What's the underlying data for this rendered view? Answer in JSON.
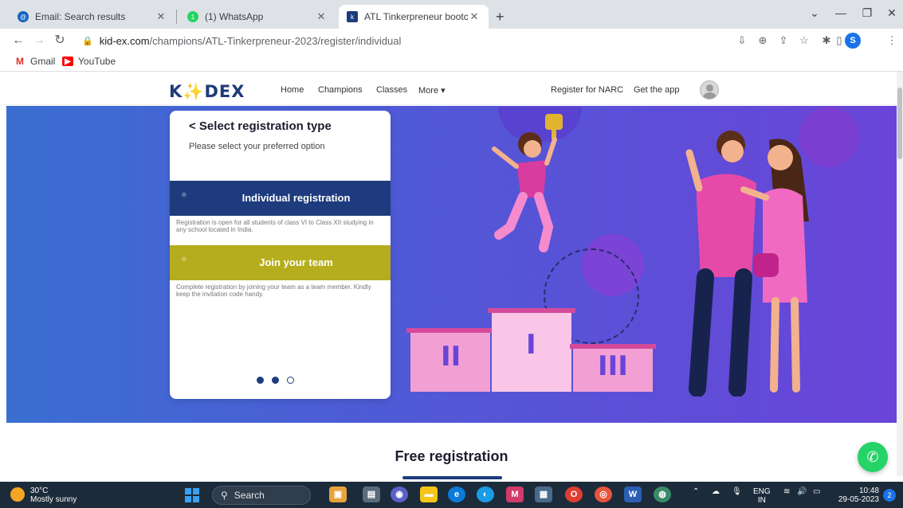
{
  "browser": {
    "tabs": [
      {
        "title": "Email: Search results",
        "favicon": "email-icon"
      },
      {
        "title": "(1) WhatsApp",
        "favicon": "whatsapp-icon"
      },
      {
        "title": "ATL Tinkerpreneur bootcamp to",
        "favicon": "kidex-icon"
      }
    ],
    "new_tab": "+",
    "url_host": "kid-ex.com",
    "url_path": "/champions/ATL-Tinkerpreneur-2023/register/individual",
    "profile_initial": "S",
    "bookmarks": [
      "Gmail",
      "YouTube"
    ]
  },
  "site": {
    "logo_k": "K",
    "logo_spark": "✨",
    "logo_rest": "DEX",
    "nav": [
      "Home",
      "Champions",
      "Classes",
      "More ▾"
    ],
    "register_narc": "Register for NARC",
    "get_app": "Get the app"
  },
  "card": {
    "title": "< Select registration type",
    "subtitle": "Please select your preferred option",
    "option1_label": "Individual registration",
    "option1_desc": "Registration is open for all students of class VI to Class XII studying in any school located in India.",
    "option2_label": "Join your team",
    "option2_desc": "Complete registration by joining your team as a team member. Kindly keep the invitation code handy.",
    "dots": 3,
    "active_dot": 2
  },
  "podium": {
    "first": "I",
    "second": "II",
    "third": "III"
  },
  "section": {
    "title": "Free registration"
  },
  "taskbar": {
    "temp": "30°C",
    "weather": "Mostly sunny",
    "search": "Search",
    "lang": "ENG",
    "lang_region": "IN",
    "time": "10:48",
    "date": "29-05-2023",
    "notifications": "2"
  },
  "colors": {
    "hero_start": "#3a6fd1",
    "hero_end": "#6a44d8",
    "option1": "#1d3b7d",
    "option2": "#b5ad1d",
    "podium": "#f4a6d7"
  }
}
